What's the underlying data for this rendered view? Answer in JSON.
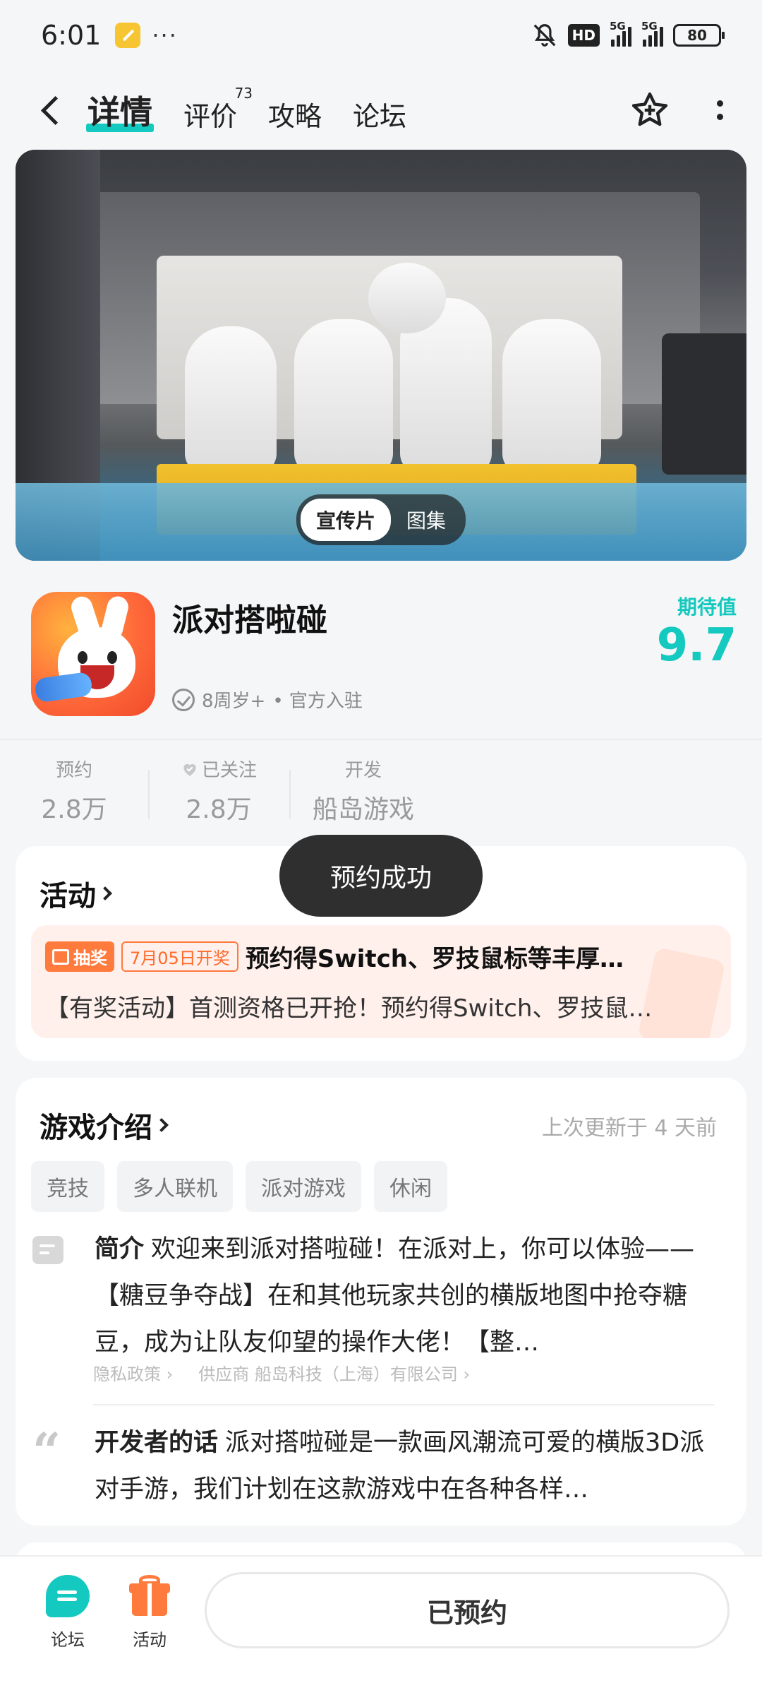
{
  "status_bar": {
    "time": "6:01",
    "dots": "···",
    "hd": "HD",
    "sig1": "5G",
    "sig2": "5G",
    "battery": "80"
  },
  "nav": {
    "tabs": [
      {
        "label": "详情",
        "badge": ""
      },
      {
        "label": "评价",
        "badge": "73"
      },
      {
        "label": "攻略",
        "badge": ""
      },
      {
        "label": "论坛",
        "badge": ""
      }
    ]
  },
  "banner": {
    "options": [
      "宣传片",
      "图集"
    ],
    "selected": "宣传片"
  },
  "game": {
    "title": "派对搭啦碰",
    "age": "8周岁+",
    "official": "• 官方入驻",
    "score_label": "期待值",
    "score_value": "9.7"
  },
  "stats": [
    {
      "key": "预约",
      "value": "2.8万"
    },
    {
      "key": "已关注",
      "value": "2.8万"
    },
    {
      "key": "开发",
      "value": "船岛游戏"
    }
  ],
  "toast": "预约成功",
  "activity": {
    "title": "活动",
    "tag": "抽奖",
    "date": "7月05日开奖",
    "headline": "预约得Switch、罗技鼠标等丰厚…",
    "desc": "【有奖活动】首测资格已开抢！预约得Switch、罗技鼠…"
  },
  "intro": {
    "title": "游戏介绍",
    "updated": "上次更新于 4 天前",
    "tags": [
      "竞技",
      "多人联机",
      "派对游戏",
      "休闲"
    ],
    "summary_label": "简介",
    "summary": "欢迎来到派对搭啦碰！在派对上，你可以体验——【糖豆争夺战】在和其他玩家共创的横版地图中抢夺糖豆，成为让队友仰望的操作大佬！【整…",
    "privacy": "隐私政策",
    "supplier": "供应商 船岛科技（上海）有限公司",
    "dev_label": "开发者的话",
    "dev_text": "派对搭啦碰是一款画风潮流可爱的横版3D派对手游，我们计划在这款游戏中在各种各样…"
  },
  "bottom_bar": {
    "forum": "论坛",
    "activity": "活动",
    "reserve": "已预约"
  },
  "colors": {
    "accent": "#14c9bf",
    "orange": "#ff7a3d",
    "toast_bg": "#2f2f2f"
  }
}
